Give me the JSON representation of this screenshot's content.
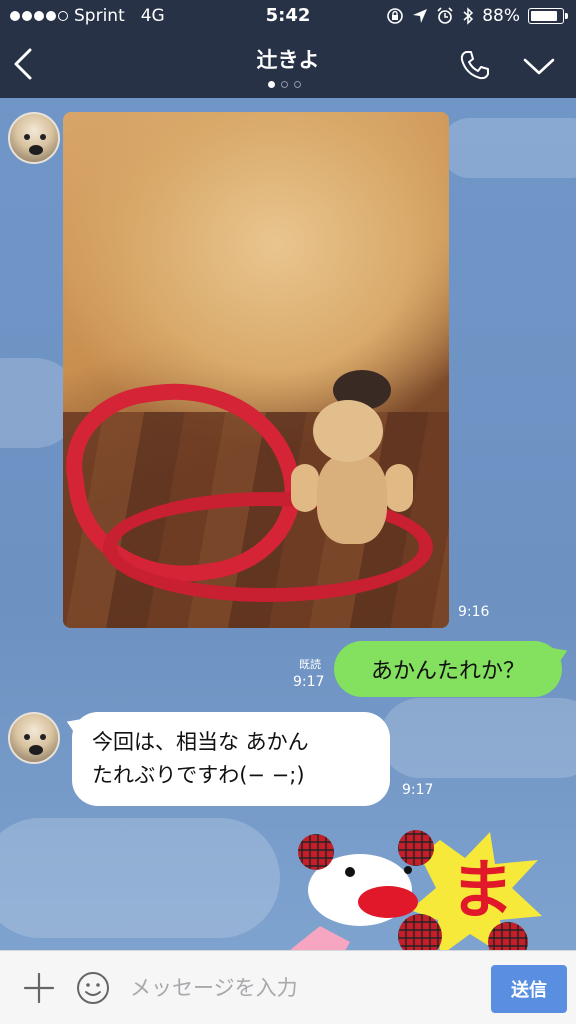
{
  "status_bar": {
    "carrier": "Sprint",
    "network": "4G",
    "time": "5:42",
    "battery": "88%",
    "battery_level": 0.88,
    "signal_bars": 4
  },
  "header": {
    "title": "辻きよ",
    "page_count": 3,
    "active_page": 1
  },
  "messages": [
    {
      "type": "image",
      "from": "incoming",
      "time": "9:16"
    },
    {
      "type": "text",
      "from": "outgoing",
      "text": "あかんたれか？",
      "read": "既読",
      "time": "9:17"
    },
    {
      "type": "text",
      "from": "incoming",
      "line1": "今回は、相当な あかん",
      "line2": "たれぶりですわ(− −;)",
      "time": "9:17"
    },
    {
      "type": "sticker",
      "from": "incoming",
      "sticker_text": "ま"
    }
  ],
  "input": {
    "placeholder": "メッセージを入力",
    "send_label": "送信"
  },
  "colors": {
    "header_bg": "#273247",
    "chat_bg": "#6f93bf",
    "outgoing_bubble": "#84e05f",
    "send_button": "#5a8ee0"
  }
}
